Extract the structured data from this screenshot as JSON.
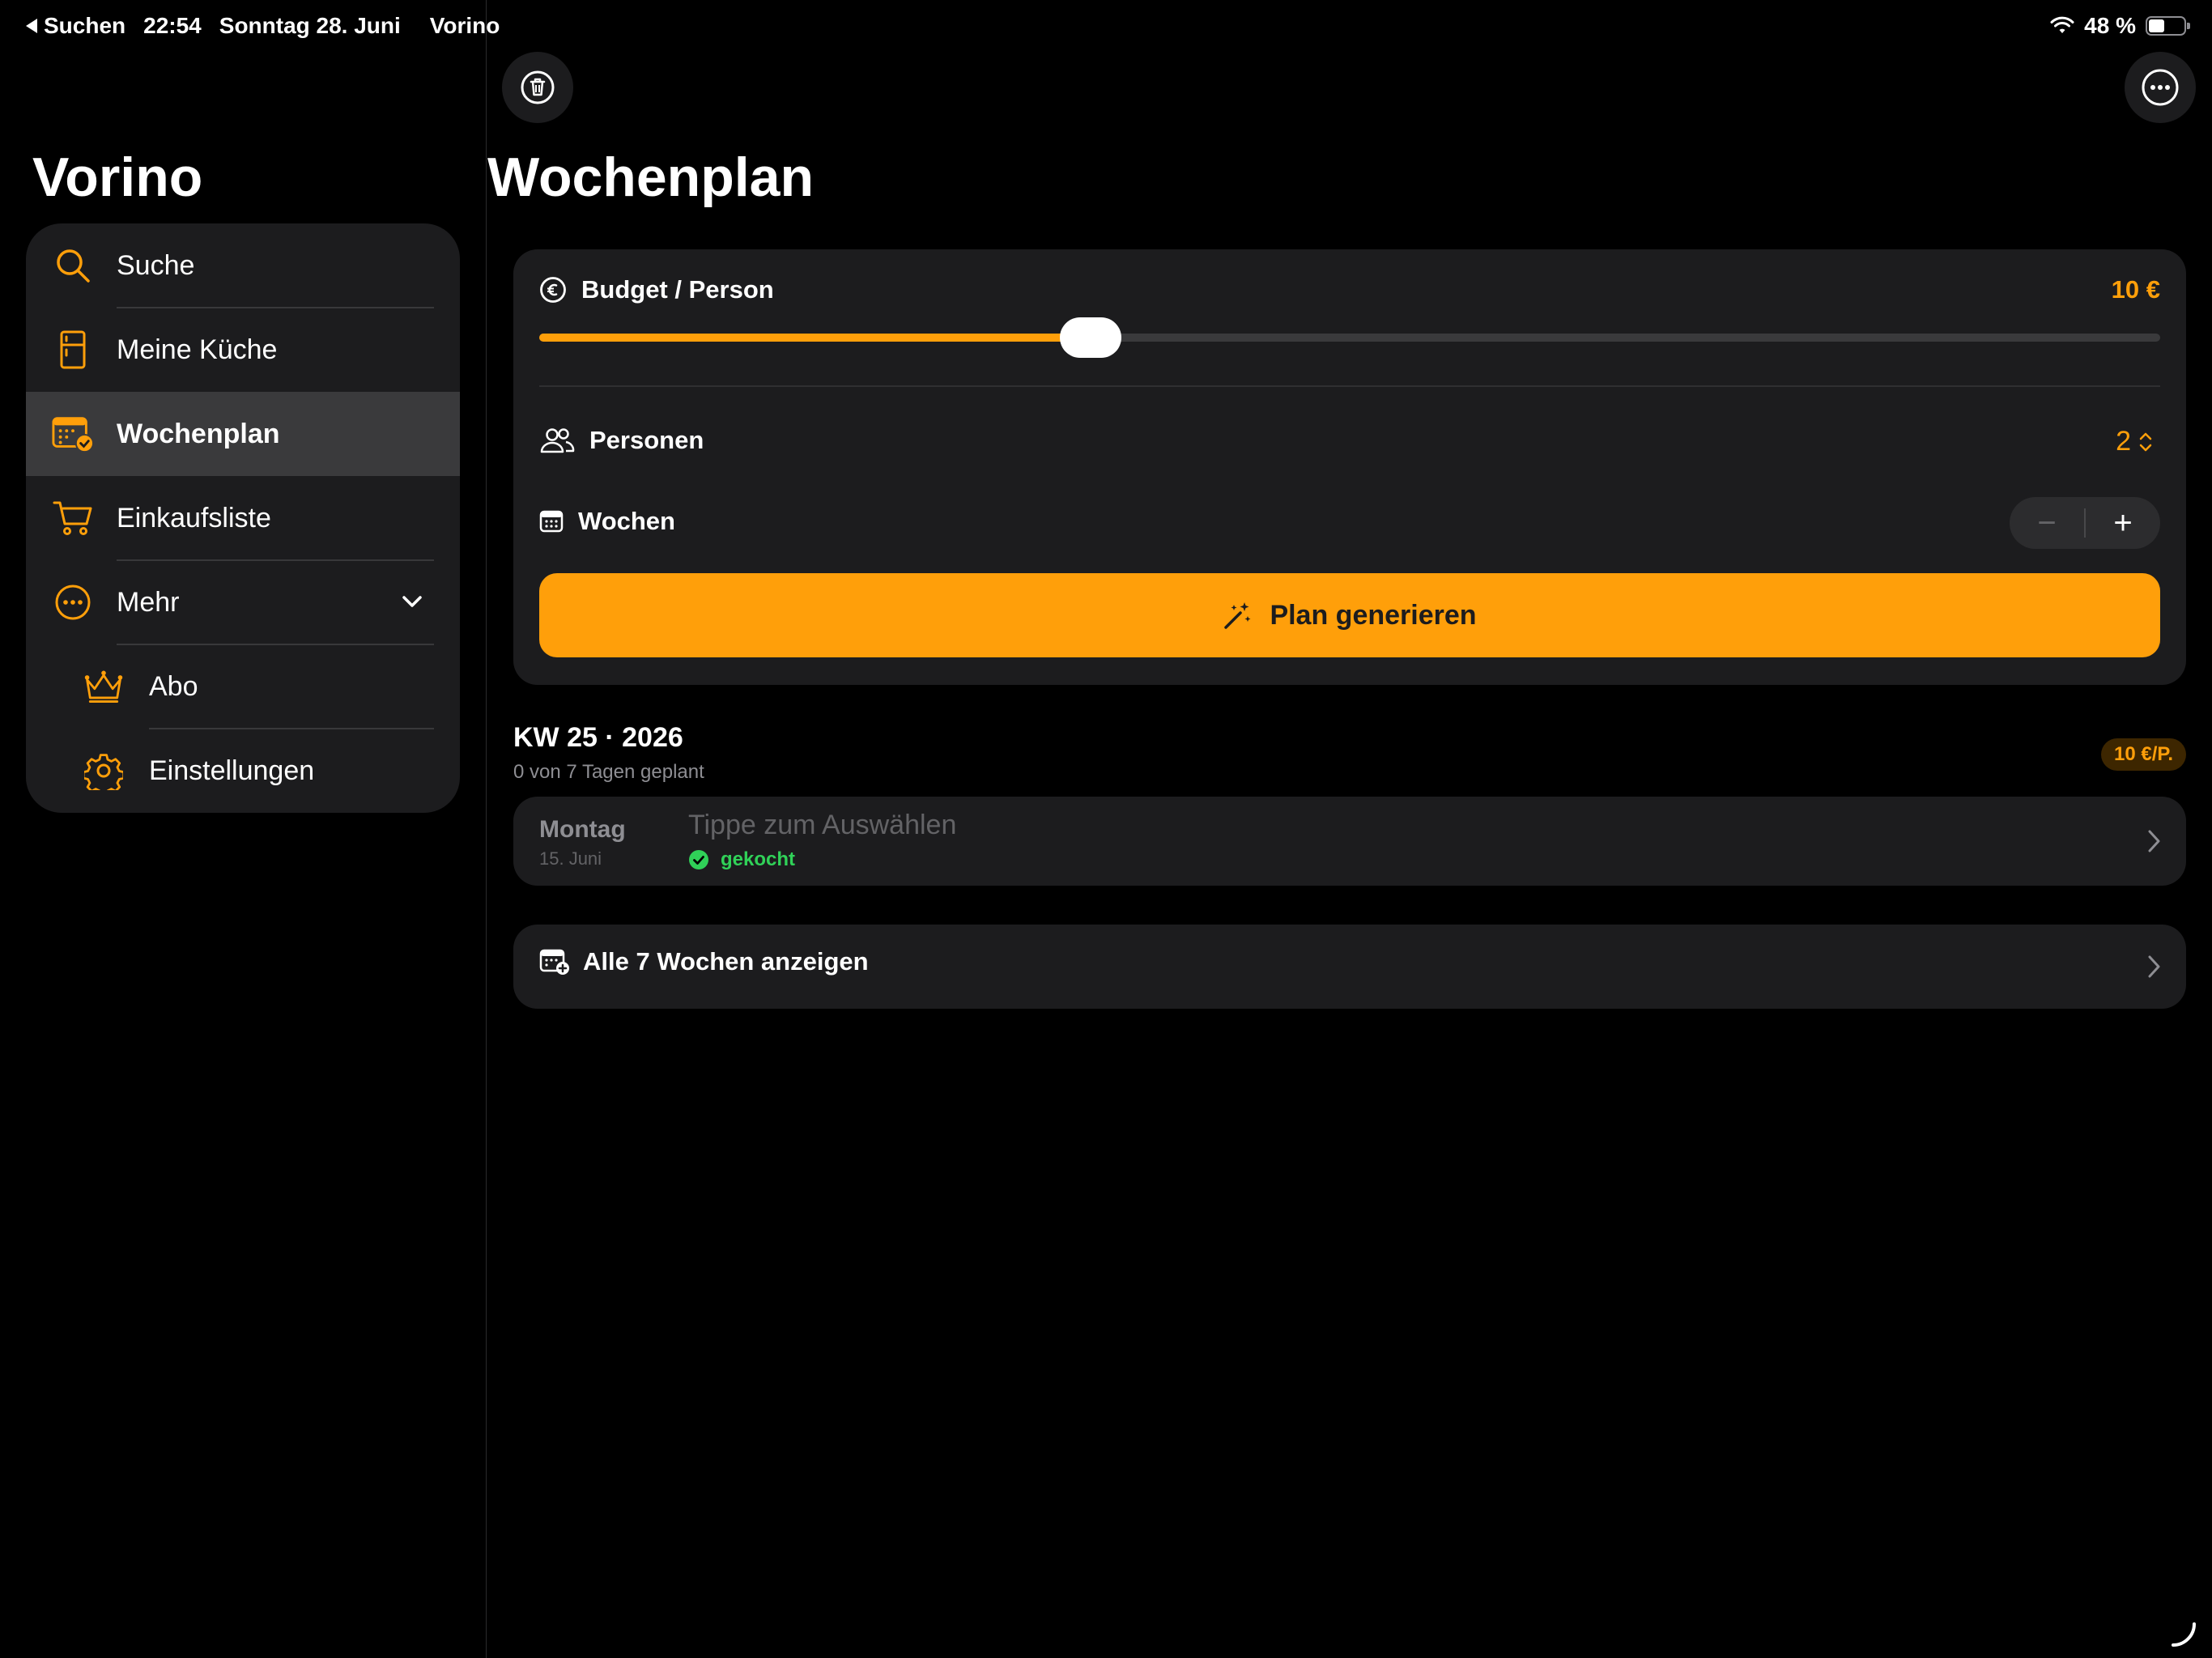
{
  "status_bar": {
    "back_label": "Suchen",
    "time": "22:54",
    "date": "Sonntag 28. Juni",
    "app_name": "Vorino",
    "battery": "48 %",
    "battery_level": 0.48
  },
  "sidebar": {
    "title": "Vorino",
    "items": [
      {
        "label": "Suche",
        "icon": "search-icon"
      },
      {
        "label": "Meine Küche",
        "icon": "fridge-icon"
      },
      {
        "label": "Wochenplan",
        "icon": "calendar-check-icon",
        "active": true
      },
      {
        "label": "Einkaufsliste",
        "icon": "cart-icon"
      },
      {
        "label": "Mehr",
        "icon": "more-circle-icon",
        "expanded": true
      }
    ],
    "subitems": [
      {
        "label": "Abo",
        "icon": "crown-icon"
      },
      {
        "label": "Einstellungen",
        "icon": "gear-icon"
      }
    ]
  },
  "toolbar": {
    "delete_icon": "trash-icon",
    "more_icon": "ellipsis-circle-icon"
  },
  "main": {
    "title": "Wochenplan",
    "budget": {
      "label": "Budget / Person",
      "value": "10 €",
      "slider_fraction": 0.34
    },
    "persons": {
      "label": "Personen",
      "value": "2"
    },
    "weeks": {
      "label": "Wochen",
      "minus": "−",
      "plus": "+"
    },
    "generate_button": "Plan generieren",
    "week": {
      "title": "KW 25 · 2026",
      "subtitle": "0 von 7 Tagen geplant",
      "badge": "10 €/P."
    },
    "day": {
      "name": "Montag",
      "date": "15. Juni",
      "hint": "Tippe zum Auswählen",
      "status": "gekocht"
    },
    "all_weeks": "Alle 7 Wochen anzeigen"
  },
  "colors": {
    "accent": "#ff9f0a",
    "success": "#30d158",
    "card": "#1c1c1e",
    "background": "#000000"
  }
}
